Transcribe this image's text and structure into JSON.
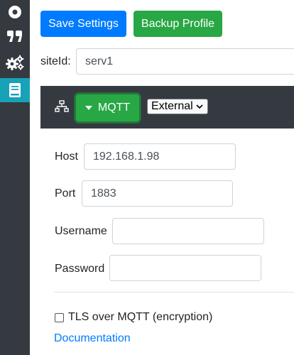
{
  "sidebar": {
    "items": [
      {
        "icon": "record-icon"
      },
      {
        "icon": "quote-icon"
      },
      {
        "icon": "cogs-icon"
      },
      {
        "icon": "book-icon",
        "active": true
      }
    ]
  },
  "toolbar": {
    "save_label": "Save Settings",
    "backup_label": "Backup Profile"
  },
  "site": {
    "label": "siteId:",
    "value": "serv1"
  },
  "mqtt": {
    "button_label": "MQTT",
    "mode_selected": "External",
    "host_label": "Host",
    "host_value": "192.168.1.98",
    "port_label": "Port",
    "port_value": "1883",
    "username_label": "Username",
    "username_value": "",
    "password_label": "Password",
    "password_value": "",
    "tls_label": "TLS over MQTT (encryption)",
    "tls_checked": false,
    "doc_link": "Documentation"
  },
  "colors": {
    "primary": "#007bff",
    "success": "#28a745",
    "dark": "#343a40",
    "info": "#17a2b8"
  }
}
